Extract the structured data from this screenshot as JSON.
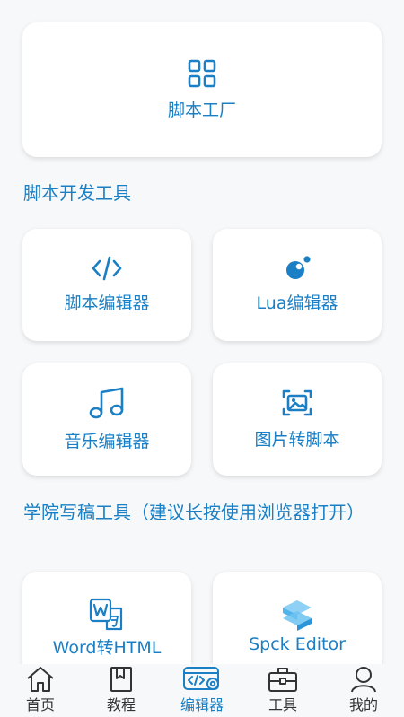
{
  "top_card": {
    "label": "脚本工厂",
    "icon": "grid-icon"
  },
  "section1": {
    "title": "脚本开发工具"
  },
  "dev_tools": [
    {
      "label": "脚本编辑器",
      "icon": "code-icon"
    },
    {
      "label": "Lua编辑器",
      "icon": "lua-icon"
    },
    {
      "label": "音乐编辑器",
      "icon": "music-note-icon"
    },
    {
      "label": "图片转脚本",
      "icon": "image-icon"
    }
  ],
  "section2": {
    "title": "学院写稿工具（建议长按使用浏览器打开）"
  },
  "writing_tools": [
    {
      "label": "Word转HTML",
      "icon": "word-html-icon"
    },
    {
      "label": "Spck Editor",
      "icon": "spck-logo-icon"
    }
  ],
  "tabbar": {
    "items": [
      {
        "label": "首页",
        "icon": "home-icon"
      },
      {
        "label": "教程",
        "icon": "book-icon"
      },
      {
        "label": "编辑器",
        "icon": "editor-gear-icon",
        "active": true
      },
      {
        "label": "工具",
        "icon": "toolbox-icon"
      },
      {
        "label": "我的",
        "icon": "user-icon"
      }
    ]
  },
  "colors": {
    "accent": "#1a7fc4",
    "background": "#f7f8fa",
    "card": "#ffffff"
  }
}
